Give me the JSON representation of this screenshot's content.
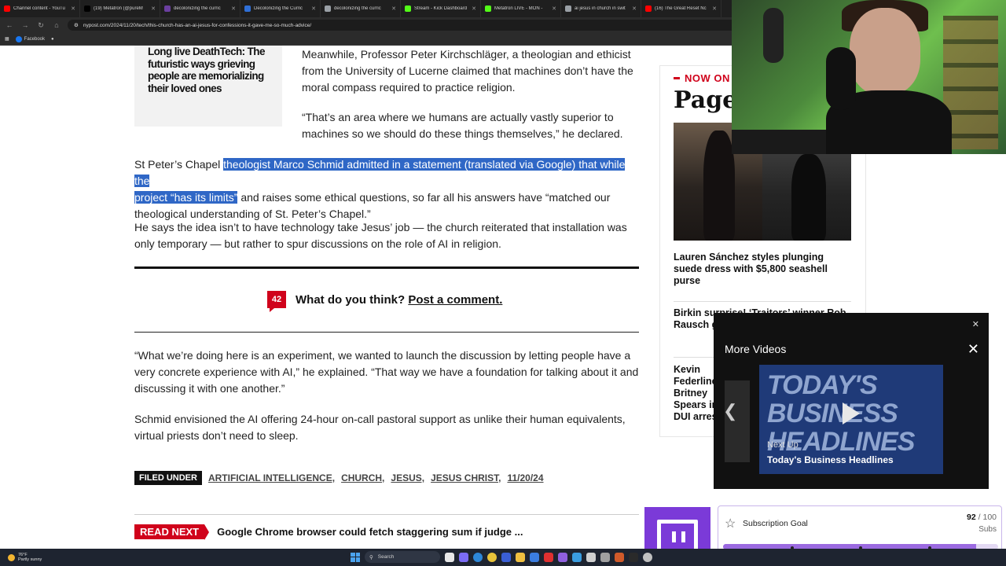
{
  "browser": {
    "tabs": [
      {
        "label": "Channel content - YouTu",
        "color": "#ff0000"
      },
      {
        "label": "(19) Metatron (@pureM",
        "color": "#000000"
      },
      {
        "label": "decolonizing the curric",
        "color": "#6b3fa0"
      },
      {
        "label": "Decolonizing the Curric",
        "color": "#2f6fd6"
      },
      {
        "label": "decolonizing the curric",
        "color": "#9aa0a6"
      },
      {
        "label": "Stream - Kick Dashboard",
        "color": "#53fc18"
      },
      {
        "label": "Metatron LIVE - MON -",
        "color": "#53fc18"
      },
      {
        "label": "ai jesus in church in swit",
        "color": "#9aa0a6"
      },
      {
        "label": "(16) The Great Reset Nc",
        "color": "#ff0000"
      }
    ],
    "url": "nypost.com/2024/11/20/tech/this-church-has-an-ai-jesus-for-confessions-it-gave-me-so-much-advice/",
    "bookmark": "Facebook"
  },
  "article": {
    "sidebox_title": "Long live DeathTech: The futuristic ways grieving people are memorializing their loved ones",
    "para1": "Meanwhile, Professor Peter Kirchschläger, a theologian and ethicist from the University of Lucerne claimed that machines don’t have the moral compass required to practice religion.",
    "para2": "“That’s an area where we humans are actually vastly superior to machines so we should do these things themselves,” he declared.",
    "para3_pre": "St Peter’s Chapel ",
    "para3_hl1": "theologist Marco Schmid admitted in a statement (translated via Google) that while the",
    "para3_hl2": "project “has its limits”",
    "para3_post": " and raises some ethical questions, so far all his answers have “matched our theological understanding of St. Peter’s Chapel.”",
    "para4": "He says the idea isn’t to have technology take Jesus’ job — the church reiterated that installation was only temporary — but rather to spur discussions on the role of AI in religion.",
    "comment_count": "42",
    "comment_prompt": "What do you think?",
    "comment_link": "Post a comment.",
    "para5": "“What we’re doing here is an experiment, we wanted to launch the discussion by letting people have a very concrete experience with AI,” he explained. “That way we have a foundation for talking about it and discussing it with one another.”",
    "para6": "Schmid envisioned the AI offering 24-hour on-call pastoral support as unlike their human equivalents, virtual priests don’t need to sleep.",
    "filed_under": "FILED UNDER",
    "tags": [
      "ARTIFICIAL INTELLIGENCE,",
      "CHURCH,",
      "JESUS,",
      "JESUS CHRIST,",
      "11/20/24"
    ],
    "read_next_label": "READ NEXT",
    "read_next_title": "Google Chrome browser could fetch staggering sum if judge ..."
  },
  "rail": {
    "now_on": "NOW ON",
    "brand": "Page",
    "story1": "Lauren Sánchez styles plunging suede dress with $5,800 seashell purse",
    "story2": "Birkin surprise! ‘Traitors’ winner Rob Rausch gets Hermès Birkin",
    "story3": "Kevin Federline Britney Spears in DUI arrest"
  },
  "more_videos": {
    "title": "More Videos",
    "thumb_line1": "TODAY'S",
    "thumb_line2": "BUSINESS",
    "thumb_line3": "HEADLINES",
    "next_up": "Next Up",
    "next_title": "Today's Business Headlines"
  },
  "sub_goal": {
    "label": "Subscription Goal",
    "current": "92",
    "total": "/ 100",
    "unit": "Subs",
    "progress": 0.92
  },
  "taskbar": {
    "temp": "76°F",
    "condition": "Partly sunny",
    "search": "Search"
  }
}
